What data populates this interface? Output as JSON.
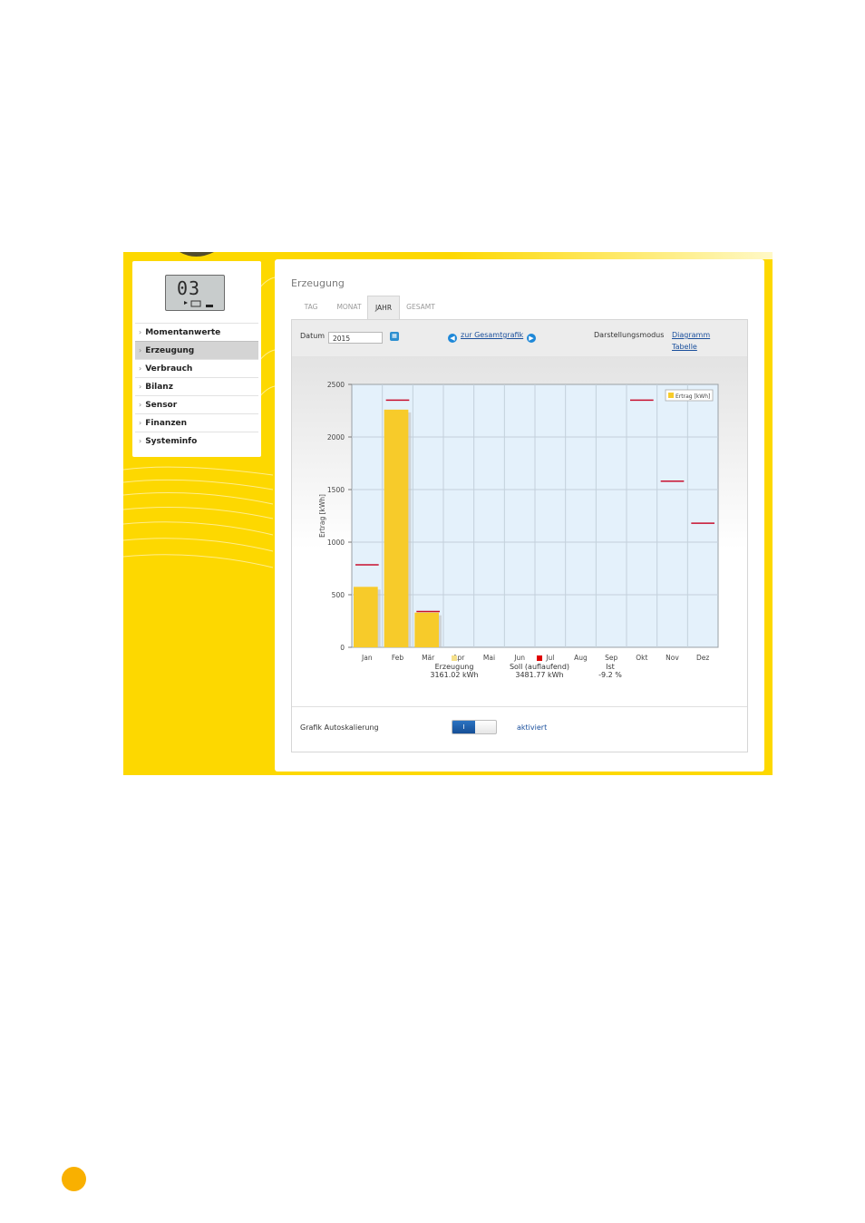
{
  "sidebar": {
    "lcd_digits": "03",
    "items": [
      {
        "label": "Momentanwerte",
        "active": false
      },
      {
        "label": "Erzeugung",
        "active": true
      },
      {
        "label": "Verbrauch",
        "active": false
      },
      {
        "label": "Bilanz",
        "active": false
      },
      {
        "label": "Sensor",
        "active": false
      },
      {
        "label": "Finanzen",
        "active": false
      },
      {
        "label": "Systeminfo",
        "active": false
      }
    ]
  },
  "page": {
    "title": "Erzeugung",
    "tabs": [
      "TAG",
      "MONAT",
      "JAHR",
      "GESAMT"
    ],
    "active_tab": "JAHR"
  },
  "toolbar": {
    "date_label": "Datum",
    "date_value": "2015",
    "nav_link": "zur Gesamtgrafik",
    "mode_label": "Darstellungsmodus",
    "mode_diagram": "Diagramm",
    "mode_table": "Tabelle"
  },
  "chart_data": {
    "type": "bar",
    "categories": [
      "Jan",
      "Feb",
      "Mär",
      "Apr",
      "Mai",
      "Jun",
      "Jul",
      "Aug",
      "Sep",
      "Okt",
      "Nov",
      "Dez"
    ],
    "series": [
      {
        "name": "Ertrag [kWh]",
        "values": [
          575,
          2260,
          330,
          null,
          null,
          null,
          null,
          null,
          null,
          null,
          null,
          null
        ],
        "color": "#f7cb2a"
      }
    ],
    "targets": [
      785,
      2350,
      340,
      null,
      null,
      null,
      null,
      null,
      null,
      2350,
      1580,
      1180
    ],
    "target_color": "#c8102e",
    "ylabel": "Ertrag [kWh]",
    "ylim": [
      0,
      2500
    ],
    "yticks": [
      0,
      500,
      1000,
      1500,
      2000,
      2500
    ],
    "grid": true,
    "legend_position": "top-right",
    "plot_background": "#e4f1fb"
  },
  "summary": [
    {
      "label": "Erzeugung",
      "value": "3161.02 kWh",
      "color": "#f5e08a"
    },
    {
      "label": "Soll (auflaufend)",
      "value": "3481.77 kWh",
      "color": "#e00000"
    },
    {
      "label": "Ist",
      "value": "-9.2 %",
      "color": ""
    }
  ],
  "autoscale": {
    "label": "Grafik Autoskalierung",
    "toggle_on": "I",
    "state": "aktiviert"
  }
}
